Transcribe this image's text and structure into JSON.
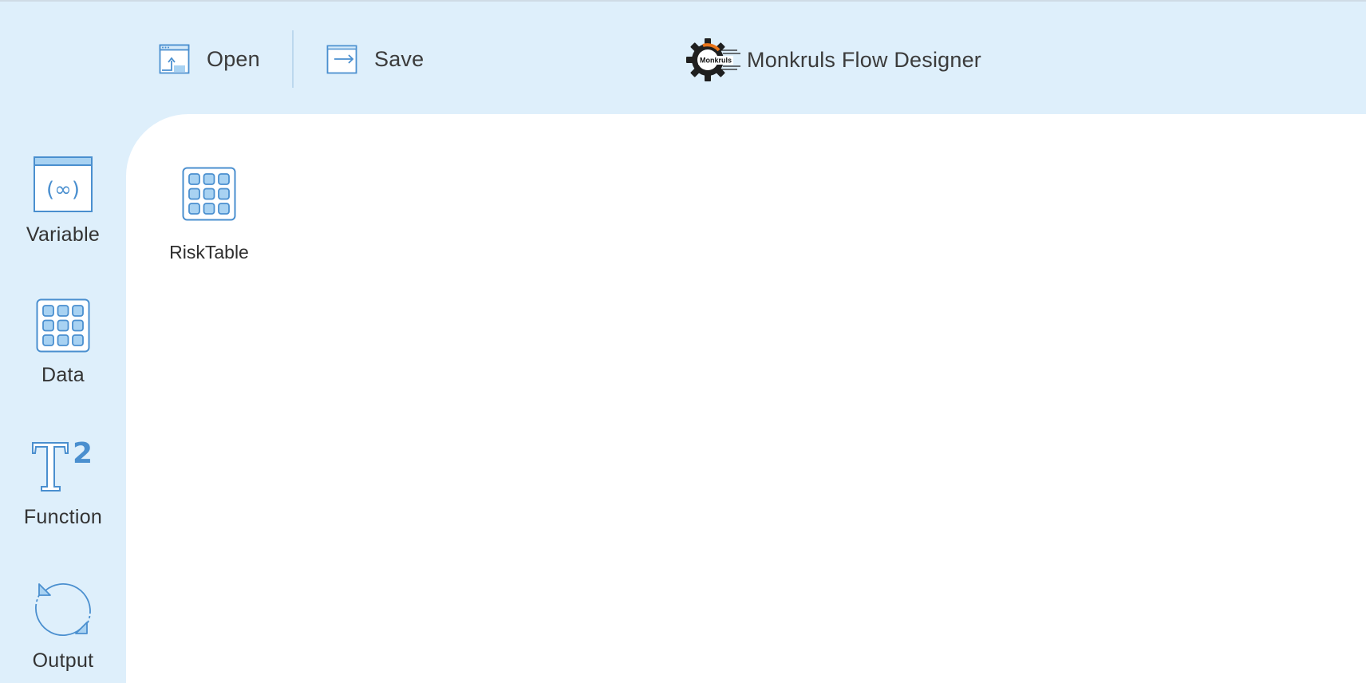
{
  "toolbar": {
    "open_label": "Open",
    "save_label": "Save"
  },
  "brand": {
    "logo_text": "Monkruls",
    "title": "Monkruls Flow Designer"
  },
  "palette": {
    "items": [
      {
        "label": "Variable",
        "icon": "variable-icon"
      },
      {
        "label": "Data",
        "icon": "data-grid-icon"
      },
      {
        "label": "Function",
        "icon": "function-icon"
      },
      {
        "label": "Output",
        "icon": "output-cycle-icon"
      }
    ]
  },
  "canvas": {
    "nodes": [
      {
        "label": "RiskTable",
        "icon": "data-grid-icon"
      }
    ]
  },
  "colors": {
    "toolbar_bg": "#deeffb",
    "canvas_bg": "#ffffff",
    "icon_stroke": "#4a8fcf",
    "icon_fill": "#a8d2f2"
  }
}
